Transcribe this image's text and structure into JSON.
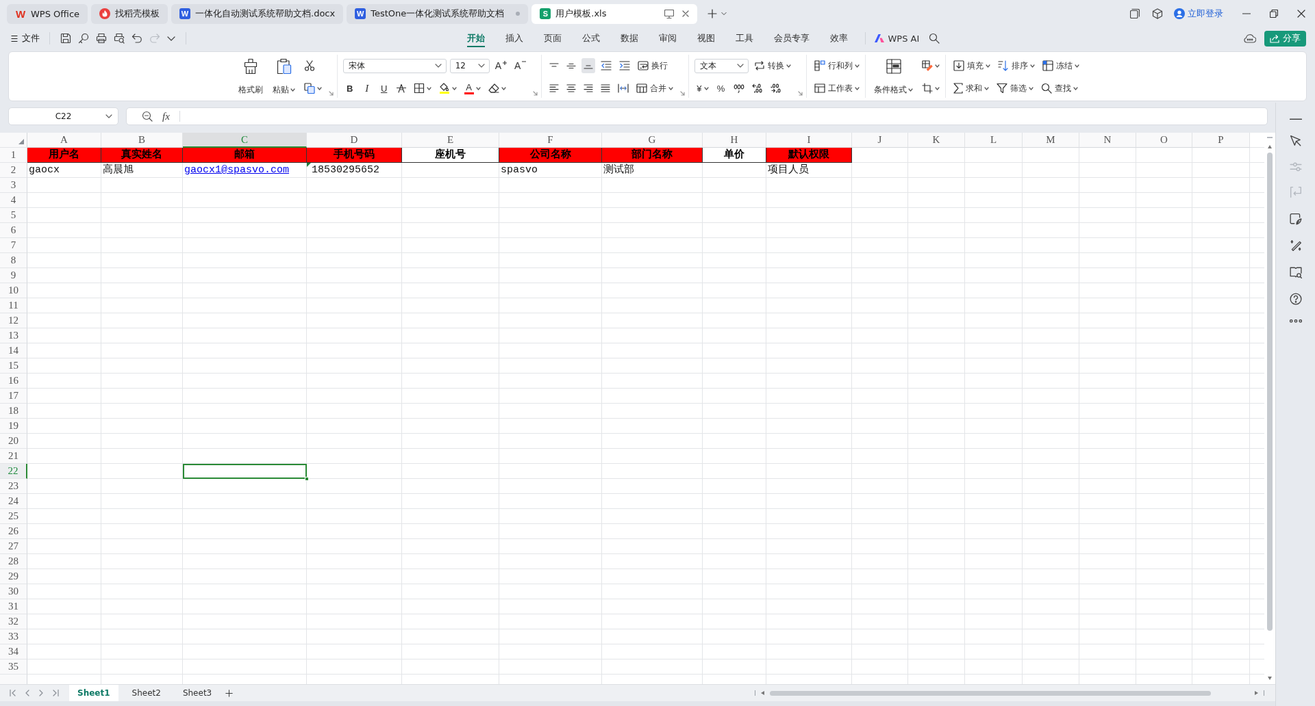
{
  "title_bar": {
    "tabs": [
      {
        "kind": "home",
        "logo": "W",
        "label": "WPS Office",
        "selected": false,
        "modified": false
      },
      {
        "kind": "templates",
        "label": "找稻壳模板",
        "selected": false,
        "modified": false
      },
      {
        "kind": "document",
        "logo": "W",
        "label": "一体化自动测试系统帮助文档.docx",
        "selected": false,
        "modified": false
      },
      {
        "kind": "document",
        "logo": "W",
        "label": "TestOne一体化测试系统帮助文档",
        "selected": false,
        "modified": true
      },
      {
        "kind": "spreadsheet",
        "logo": "S",
        "label": "用户模板.xls",
        "selected": true,
        "modified": false
      }
    ],
    "login": "立即登录"
  },
  "menu_bar": {
    "file_menu": "文件",
    "quick_access": [
      {
        "kind": "save",
        "disabled": false
      },
      {
        "kind": "key",
        "disabled": false
      },
      {
        "kind": "print",
        "disabled": false
      },
      {
        "kind": "preview",
        "disabled": false
      },
      {
        "kind": "undo",
        "disabled": false
      },
      {
        "kind": "redo",
        "disabled": true
      },
      {
        "kind": "more",
        "disabled": false
      }
    ],
    "tabs": [
      {
        "label": "开始",
        "selected": true
      },
      {
        "label": "插入",
        "selected": false
      },
      {
        "label": "页面",
        "selected": false
      },
      {
        "label": "公式",
        "selected": false
      },
      {
        "label": "数据",
        "selected": false
      },
      {
        "label": "审阅",
        "selected": false
      },
      {
        "label": "视图",
        "selected": false
      },
      {
        "label": "工具",
        "selected": false
      },
      {
        "label": "会员专享",
        "selected": false
      },
      {
        "label": "效率",
        "selected": false
      }
    ],
    "ai_button": "WPS AI",
    "share_button": "分享"
  },
  "ribbon": {
    "groups": [
      {
        "launcher": true,
        "large": [
          {
            "kind": "format_painter",
            "label": "格式刷",
            "dropdown": false
          },
          {
            "kind": "paste",
            "label": "粘贴",
            "dropdown": true
          }
        ],
        "upper": [
          {
            "kind": "cut",
            "dropdown": false
          }
        ],
        "lower": [
          {
            "kind": "copy",
            "dropdown": true
          }
        ]
      },
      {
        "launcher": true,
        "upper": [
          {
            "kind": "font_name",
            "value": "宋体",
            "dropdown": true
          },
          {
            "kind": "font_size",
            "value": "12",
            "dropdown": true
          },
          {
            "kind": "grow",
            "symbol": "A",
            "dropdown": false
          },
          {
            "kind": "shrink",
            "symbol": "A",
            "dropdown": false
          }
        ],
        "lower": [
          {
            "kind": "bold",
            "symbol": "B",
            "dropdown": false
          },
          {
            "kind": "italic",
            "symbol": "I",
            "dropdown": false
          },
          {
            "kind": "underline",
            "symbol": "U",
            "dropdown": false
          },
          {
            "kind": "strikethrough",
            "dropdown": false
          },
          {
            "kind": "borders",
            "dropdown": true
          },
          {
            "kind": "fill_color",
            "color": "#ffff00",
            "dropdown": true
          },
          {
            "kind": "font_color",
            "symbol": "A",
            "color": "#ff0000",
            "dropdown": true
          },
          {
            "kind": "clear",
            "dropdown": true
          }
        ]
      },
      {
        "launcher": true,
        "upper": [
          {
            "kind": "align_top",
            "selected": false,
            "dropdown": false
          },
          {
            "kind": "align_middle",
            "selected": false,
            "dropdown": false
          },
          {
            "kind": "align_bottom",
            "selected": true,
            "dropdown": false
          },
          {
            "kind": "outdent",
            "dropdown": false
          },
          {
            "kind": "indent",
            "dropdown": false
          },
          {
            "kind": "wrap",
            "label": "换行",
            "dropdown": false
          }
        ],
        "lower": [
          {
            "kind": "align_left",
            "selected": false,
            "dropdown": false
          },
          {
            "kind": "align_center",
            "selected": false,
            "dropdown": false
          },
          {
            "kind": "align_right",
            "selected": false,
            "dropdown": false
          },
          {
            "kind": "justify",
            "selected": false,
            "dropdown": false
          },
          {
            "kind": "distribute",
            "selected": false,
            "dropdown": false
          },
          {
            "kind": "merge",
            "label": "合并",
            "dropdown": true
          }
        ]
      },
      {
        "launcher": true,
        "upper": [
          {
            "kind": "number_format",
            "value": "文本",
            "dropdown": true
          },
          {
            "kind": "convert",
            "label": "转换",
            "dropdown": true
          }
        ],
        "lower": [
          {
            "kind": "currency",
            "symbol": "¥",
            "dropdown": true
          },
          {
            "kind": "percent",
            "symbol": "%",
            "dropdown": false
          },
          {
            "kind": "thousands",
            "dropdown": false
          },
          {
            "kind": "decimal_more",
            "dropdown": false
          },
          {
            "kind": "decimal_less",
            "dropdown": false
          }
        ]
      },
      {
        "launcher": false,
        "upper": [
          {
            "kind": "rows_columns",
            "label": "行和列",
            "dropdown": true
          }
        ],
        "lower": [
          {
            "kind": "worksheet",
            "label": "工作表",
            "dropdown": true
          }
        ]
      },
      {
        "launcher": false,
        "large": [
          {
            "kind": "conditional_format",
            "label": "条件格式",
            "dropdown": true
          }
        ],
        "upper": [
          {
            "kind": "cell_style",
            "dropdown": true
          }
        ],
        "lower": [
          {
            "kind": "cell_border",
            "dropdown": true
          }
        ]
      },
      {
        "launcher": false,
        "upper": [
          {
            "kind": "fill",
            "label": "填充",
            "dropdown": true
          },
          {
            "kind": "sort",
            "label": "排序",
            "dropdown": true
          },
          {
            "kind": "freeze",
            "label": "冻结",
            "dropdown": true
          }
        ],
        "lower": [
          {
            "kind": "sum",
            "label": "求和",
            "dropdown": true
          },
          {
            "kind": "filter",
            "label": "筛选",
            "dropdown": true
          },
          {
            "kind": "find",
            "label": "查找",
            "dropdown": true
          }
        ]
      }
    ]
  },
  "formula_bar": {
    "name_box": "C22",
    "function_label": "fx"
  },
  "sheet": {
    "columns": [
      {
        "label": "A",
        "selected": false
      },
      {
        "label": "B",
        "selected": false
      },
      {
        "label": "C",
        "selected": true
      },
      {
        "label": "D",
        "selected": false
      },
      {
        "label": "E",
        "selected": false
      },
      {
        "label": "F",
        "selected": false
      },
      {
        "label": "G",
        "selected": false
      },
      {
        "label": "H",
        "selected": false
      },
      {
        "label": "I",
        "selected": false
      },
      {
        "label": "J",
        "selected": false
      },
      {
        "label": "K",
        "selected": false
      },
      {
        "label": "L",
        "selected": false
      },
      {
        "label": "M",
        "selected": false
      },
      {
        "label": "N",
        "selected": false
      },
      {
        "label": "O",
        "selected": false
      },
      {
        "label": "P",
        "selected": false
      }
    ],
    "rows": [
      {
        "label": "1",
        "selected": false,
        "cells": [
          {
            "kind": "header",
            "text": "用户名",
            "color": "#ff0000"
          },
          {
            "kind": "header",
            "text": "真实姓名",
            "color": "#ff0000"
          },
          {
            "kind": "header",
            "text": "邮箱",
            "color": "#ff0000"
          },
          {
            "kind": "header",
            "text": "手机号码",
            "color": "#ff0000"
          },
          {
            "kind": "header",
            "text": "座机号",
            "color": "#ffffff"
          },
          {
            "kind": "header",
            "text": "公司名称",
            "color": "#ff0000"
          },
          {
            "kind": "header",
            "text": "部门名称",
            "color": "#ff0000"
          },
          {
            "kind": "header",
            "text": "单价",
            "color": "#ffffff"
          },
          {
            "kind": "header",
            "text": "默认权限",
            "color": "#ff0000"
          }
        ]
      },
      {
        "label": "2",
        "selected": false,
        "cells": [
          {
            "kind": "text",
            "text": "gaocx"
          },
          {
            "kind": "text",
            "text": "高晨旭"
          },
          {
            "kind": "link",
            "text": "gaocx1@spasvo.com"
          },
          {
            "kind": "flagged",
            "text": "18530295652"
          },
          null,
          {
            "kind": "text",
            "text": "spasvo"
          },
          {
            "kind": "text",
            "text": "测试部"
          },
          null,
          {
            "kind": "text",
            "text": "项目人员"
          }
        ]
      },
      {
        "label": "3",
        "selected": false
      },
      {
        "label": "4",
        "selected": false
      },
      {
        "label": "5",
        "selected": false
      },
      {
        "label": "6",
        "selected": false
      },
      {
        "label": "7",
        "selected": false
      },
      {
        "label": "8",
        "selected": false
      },
      {
        "label": "9",
        "selected": false
      },
      {
        "label": "10",
        "selected": false
      },
      {
        "label": "11",
        "selected": false
      },
      {
        "label": "12",
        "selected": false
      },
      {
        "label": "13",
        "selected": false
      },
      {
        "label": "14",
        "selected": false
      },
      {
        "label": "15",
        "selected": false
      },
      {
        "label": "16",
        "selected": false
      },
      {
        "label": "17",
        "selected": false
      },
      {
        "label": "18",
        "selected": false
      },
      {
        "label": "19",
        "selected": false
      },
      {
        "label": "20",
        "selected": false
      },
      {
        "label": "21",
        "selected": false
      },
      {
        "label": "22",
        "selected": true
      },
      {
        "label": "23",
        "selected": false
      },
      {
        "label": "24",
        "selected": false
      },
      {
        "label": "25",
        "selected": false
      },
      {
        "label": "26",
        "selected": false
      },
      {
        "label": "27",
        "selected": false
      },
      {
        "label": "28",
        "selected": false
      },
      {
        "label": "29",
        "selected": false
      },
      {
        "label": "30",
        "selected": false
      },
      {
        "label": "31",
        "selected": false
      },
      {
        "label": "32",
        "selected": false
      },
      {
        "label": "33",
        "selected": false
      },
      {
        "label": "34",
        "selected": false
      },
      {
        "label": "35",
        "selected": false
      }
    ]
  },
  "sheet_tabs": [
    {
      "label": "Sheet1",
      "selected": true
    },
    {
      "label": "Sheet2",
      "selected": false
    },
    {
      "label": "Sheet3",
      "selected": false
    }
  ],
  "sidebar": [
    {
      "kind": "collapse",
      "disabled": false
    },
    {
      "kind": "select",
      "disabled": false
    },
    {
      "kind": "properties",
      "disabled": true
    },
    {
      "kind": "transform",
      "disabled": true
    },
    {
      "kind": "image",
      "disabled": false
    },
    {
      "kind": "tools",
      "disabled": false
    },
    {
      "kind": "reader",
      "disabled": false
    },
    {
      "kind": "help",
      "disabled": false
    },
    {
      "kind": "more",
      "disabled": false
    }
  ]
}
